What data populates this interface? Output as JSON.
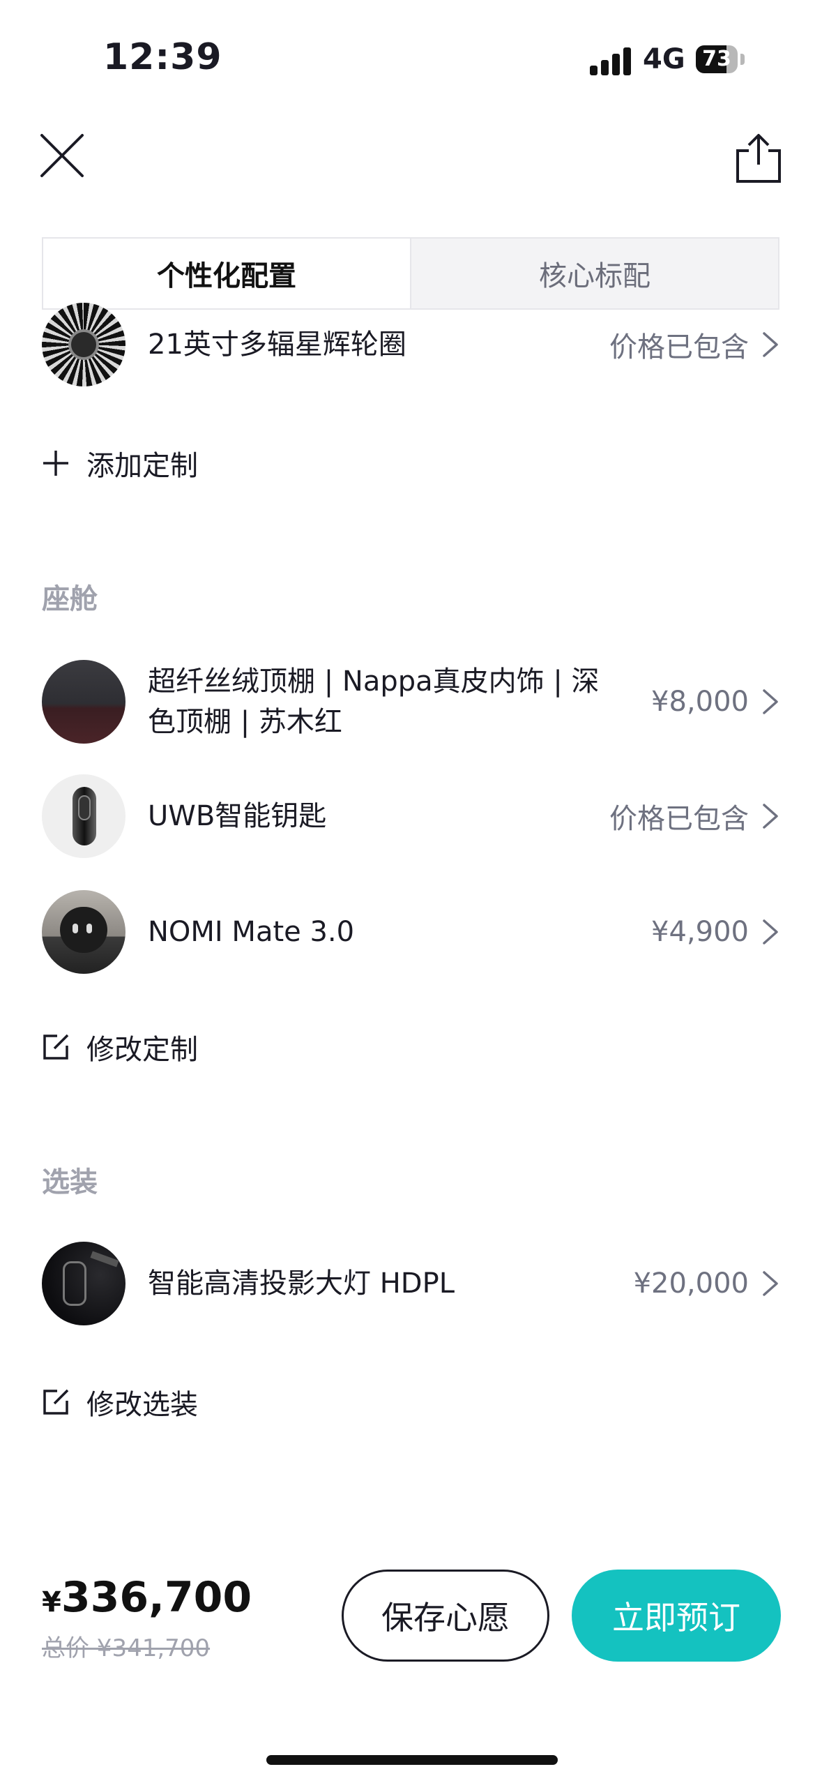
{
  "status_bar": {
    "time": "12:39",
    "network": "4G",
    "battery": "73",
    "battery_level": 0.73
  },
  "tabs": [
    {
      "label": "个性化配置",
      "active": true
    },
    {
      "label": "核心标配",
      "active": false
    }
  ],
  "exterior": {
    "items": [
      {
        "label": "21英寸多辐星辉轮圈",
        "price": "价格已包含"
      }
    ],
    "action_label": "添加定制"
  },
  "cabin": {
    "title": "座舱",
    "items": [
      {
        "label": "超纤丝绒顶棚 | Nappa真皮内饰 | 深色顶棚 | 苏木红",
        "price": "¥8,000"
      },
      {
        "label": "UWB智能钥匙",
        "price": "价格已包含"
      },
      {
        "label": "NOMI Mate 3.0",
        "price": "¥4,900"
      }
    ],
    "action_label": "修改定制"
  },
  "options": {
    "title": "选装",
    "items": [
      {
        "label": "智能高清投影大灯 HDPL",
        "price": "¥20,000"
      }
    ],
    "action_label": "修改选装"
  },
  "bottom": {
    "currency": "¥",
    "price": "336,700",
    "original_price": "总价 ¥341,700",
    "save_label": "保存心愿",
    "order_label": "立即预订"
  },
  "colors": {
    "accent": "#14c2c0",
    "muted": "#a0a2ad",
    "text": "#1a1a24"
  },
  "icons": [
    "close-icon",
    "share-icon",
    "chevron-right-icon",
    "plus-icon",
    "edit-icon"
  ]
}
